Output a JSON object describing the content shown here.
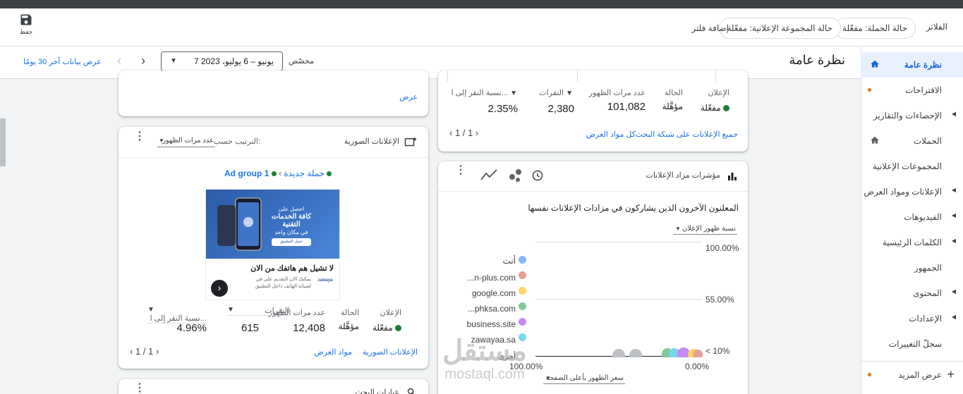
{
  "filter_bar": {
    "filters_label": "الفلاتر",
    "chips": [
      "حالة الحملة: مفعّلة",
      "حالة المجموعة الإعلانية: مفعّلة"
    ],
    "add_filter": "إضافة فلتر",
    "save_label": "حفظ"
  },
  "header": {
    "title": "نظرة عامة",
    "range_type": "مخصّص",
    "date_range": "7 يونيو – 6 يوليو، 2023",
    "last30": "عرض بيانات آخر 30 يومًا"
  },
  "sidebar": {
    "items": [
      {
        "label": "نظرة عامة",
        "active": true,
        "icon": "home-icon"
      },
      {
        "label": "الاقتراحات",
        "dot": true
      },
      {
        "label": "الإحصاءات والتقارير",
        "arrow": true
      },
      {
        "label": "الحملات",
        "icon": "home-icon"
      },
      {
        "label": "المجموعات الإعلانية"
      },
      {
        "label": "الإعلانات ومواد العرض",
        "arrow": true
      },
      {
        "label": "الفيديوهات",
        "arrow": true
      },
      {
        "label": "الكلمات الرئيسية",
        "arrow": true
      },
      {
        "label": "الجمهور"
      },
      {
        "label": "المحتوى",
        "arrow": true
      },
      {
        "label": "الإعدادات",
        "arrow": true
      },
      {
        "label": "سجلّ التغييرات"
      },
      {
        "label": "عرض المزيد",
        "dot": true
      }
    ]
  },
  "top_left_card": {
    "view": "عرض"
  },
  "search_ads_card": {
    "headers": {
      "ad": "الإعلان",
      "status": "الحالة",
      "impr": "عدد مرات الظهور",
      "clicks": "النقرات",
      "ctr": "نسبة النقر إلى ا..."
    },
    "values": {
      "ad": "مفعّلة",
      "status": "مؤهَّلة",
      "impr": "101,082",
      "clicks": "2,380",
      "ctr": "2.35%"
    },
    "all_ads": "جميع الإعلانات على شبكة البحث",
    "all_assets": "كل مواد العرض",
    "pager": "1 / 1"
  },
  "image_ads_card": {
    "title": "الإعلانات الصورية",
    "sort_by": "الترتيب حسب:",
    "sort_value": "عدد مرات الظهور",
    "breadcrumb_campaign": "حملة جديدة",
    "breadcrumb_adgroup": "Ad group 1",
    "ad_image": {
      "line1": "احصل على",
      "line2": "كافة الخدمات",
      "line3": "التقنية",
      "line4": "في مكان واحد",
      "cta": "حمل التطبيق"
    },
    "ad_headline": "لا تشيل هم هاتفك من الان",
    "ad_desc": "يمكنك الان التقديم على في لصيانة الهاتف داخل التطبيق",
    "ad_logo": "zawaya",
    "headers": {
      "ad": "الإعلان",
      "status": "الحالة",
      "impr": "عدد مرات الظهور",
      "clicks": "النقرات",
      "ctr": "نسبة النقر إلى ا..."
    },
    "values": {
      "ad": "مفعّلة",
      "status": "مؤهَّلة",
      "impr": "12,408",
      "clicks": "615",
      "ctr": "4.96%"
    },
    "link_image_ads": "الإعلانات الصورية",
    "link_assets": "مواد العرض",
    "pager": "1 / 1"
  },
  "auction_card": {
    "title": "مؤشرات مزاد الإعلانات",
    "subtitle": "المعلنون الآخرون الذين يشاركون في مزادات الإعلانات نفسها",
    "y_metric": "نسبة ظهور الإعلان",
    "x_metric": "سعر الظهور بأعلى الصفحة",
    "y_ticks": [
      "100.00%",
      "55.00%",
      "< 10%"
    ],
    "x_ticks": [
      "100.00%",
      "0.00%"
    ],
    "legend": [
      {
        "label": "أنت",
        "color": "#8ab4f8"
      },
      {
        "label": "...n-plus.com",
        "color": "#e6a096"
      },
      {
        "label": "google.com",
        "color": "#fdd663"
      },
      {
        "label": "...phksa.com",
        "color": "#81c995"
      },
      {
        "label": "business.site",
        "color": "#c58af9"
      },
      {
        "label": "zawayaa.sa",
        "color": "#78d9ec"
      },
      {
        "label": "أخرى",
        "color": "#bdc1c6"
      }
    ]
  },
  "bottom_card": {
    "title": "عبارات البحث"
  },
  "watermark": {
    "line1": "مستقل",
    "line2": "mostaql.com"
  }
}
